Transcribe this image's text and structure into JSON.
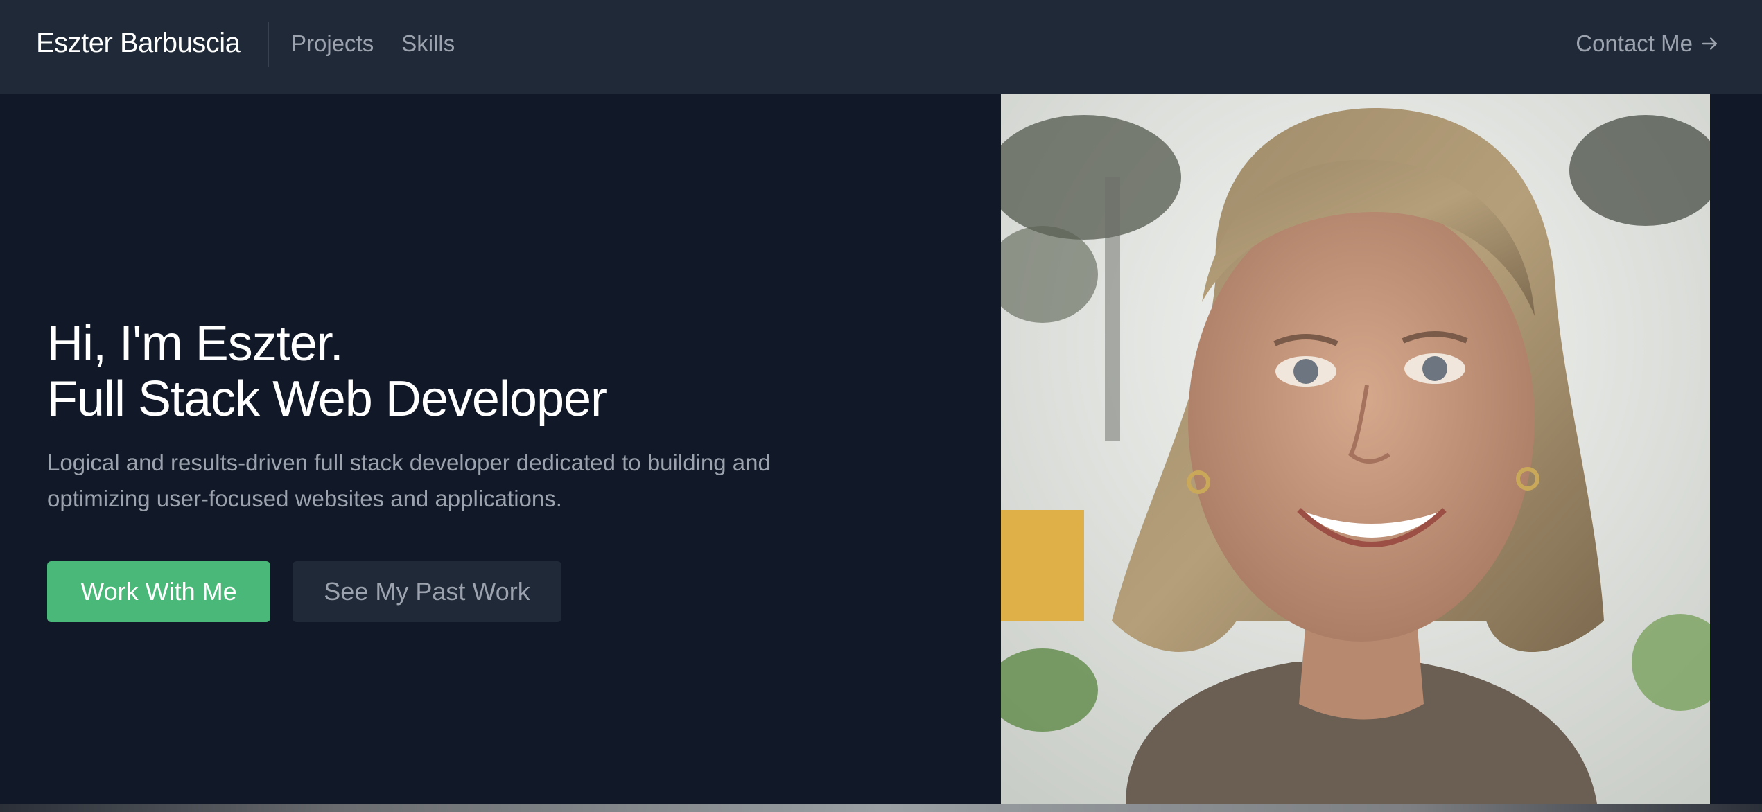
{
  "nav": {
    "brand": "Eszter Barbuscia",
    "links": [
      {
        "label": "Projects"
      },
      {
        "label": "Skills"
      }
    ],
    "contact_label": "Contact Me"
  },
  "hero": {
    "headline_line1": "Hi, I'm Eszter.",
    "headline_line2": "Full Stack Web Developer",
    "description": "Logical and results-driven full stack developer dedicated to building and optimizing user-focused websites and applications.",
    "primary_button": "Work With Me",
    "secondary_button": "See My Past Work",
    "portrait_icon": "portrait-photo"
  },
  "colors": {
    "nav_bg": "#1f2937",
    "page_bg": "#111827",
    "accent_green": "#4ab879",
    "muted_text": "#9ca3af"
  }
}
